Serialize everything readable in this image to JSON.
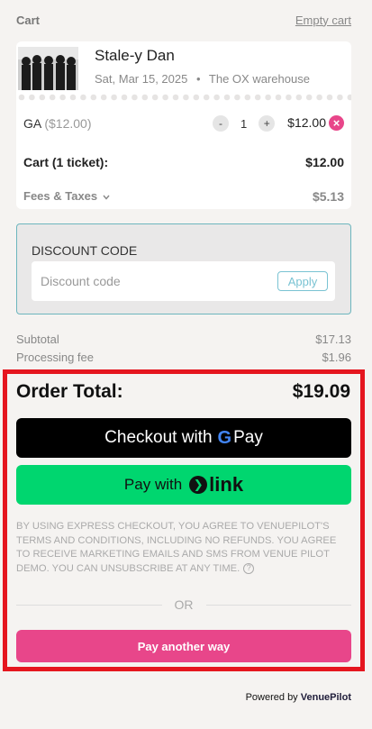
{
  "header": {
    "title": "Cart",
    "empty_cart": "Empty cart"
  },
  "event": {
    "name": "Stale-y Dan",
    "date": "Sat, Mar 15, 2025",
    "separator": "•",
    "venue": "The OX warehouse"
  },
  "ticket": {
    "type": "GA",
    "unit_price": "($12.00)",
    "quantity": "1",
    "minus": "-",
    "plus": "+",
    "line_total": "$12.00",
    "remove": "×"
  },
  "cart_line": {
    "label": "Cart (1 ticket):",
    "amount": "$12.00"
  },
  "fees": {
    "label": "Fees & Taxes",
    "amount": "$5.13"
  },
  "discount": {
    "label": "DISCOUNT CODE",
    "placeholder": "Discount code",
    "apply": "Apply"
  },
  "summary": {
    "subtotal_label": "Subtotal",
    "subtotal": "$17.13",
    "processing_label": "Processing fee",
    "processing": "$1.96"
  },
  "order_total": {
    "label": "Order Total:",
    "amount": "$19.09"
  },
  "gpay": {
    "prefix": "Checkout with",
    "g": "G",
    "pay": "Pay"
  },
  "link_pay": {
    "prefix": "Pay with",
    "word": "link"
  },
  "legal": "BY USING EXPRESS CHECKOUT, YOU AGREE TO VENUEPILOT'S TERMS AND CONDITIONS, INCLUDING NO REFUNDS. YOU AGREE TO RECEIVE MARKETING EMAILS AND SMS FROM VENUE PILOT DEMO. YOU CAN UNSUBSCRIBE AT ANY TIME.",
  "or": "OR",
  "pay_another": "Pay another way",
  "powered": {
    "prefix": "Powered by",
    "brand": "VenuePilot"
  },
  "colors": {
    "accent_pink": "#e8468a",
    "link_green": "#00d66f",
    "highlight_red": "#e5161f",
    "discount_border": "#6db6be"
  }
}
